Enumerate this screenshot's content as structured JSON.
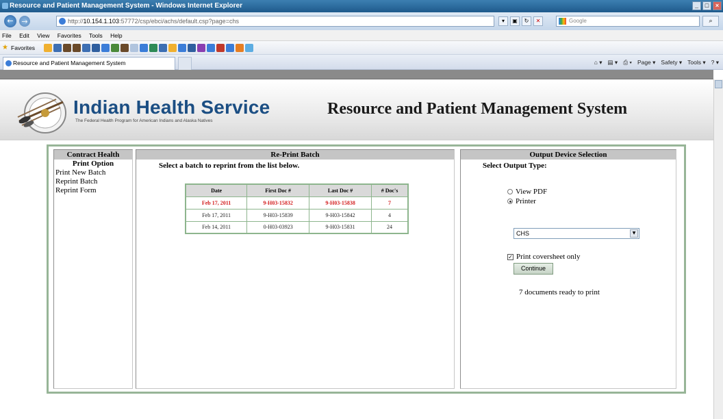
{
  "browser": {
    "window_title": "Resource and Patient Management System - Windows Internet Explorer",
    "url_prefix": "http://",
    "url_host": "10.154.1.103",
    "url_rest": ":57772/csp/ebci/achs/default.csp?page=chs",
    "search_placeholder": "Google",
    "menu": [
      "File",
      "Edit",
      "View",
      "Favorites",
      "Tools",
      "Help"
    ],
    "favorites_label": "Favorites",
    "tab_title": "Resource and Patient Management System",
    "commands": [
      "Page ▾",
      "Safety ▾",
      "Tools ▾"
    ]
  },
  "header": {
    "org_title": "Indian Health Service",
    "org_subtitle": "The Federal Health Program for American Indians and Alaska Natives",
    "system_title": "Resource and Patient Management System"
  },
  "left_panel": {
    "heading_line1": "Contract Health",
    "heading_line2": "Print Option",
    "items": [
      "Print New Batch",
      "Reprint Batch",
      "Reprint Form"
    ]
  },
  "mid_panel": {
    "heading": "Re-Print Batch",
    "instruction": "Select a batch to reprint from the list below.",
    "columns": [
      "Date",
      "First Doc #",
      "Last Doc #",
      "# Doc's"
    ],
    "rows": [
      {
        "date": "Feb 17, 2011",
        "first": "9-H03-15832",
        "last": "9-H03-15838",
        "count": "7"
      },
      {
        "date": "Feb 17, 2011",
        "first": "9-H03-15839",
        "last": "9-H03-15842",
        "count": "4"
      },
      {
        "date": "Feb 14, 2011",
        "first": "0-H03-03923",
        "last": "9-H03-15831",
        "count": "24"
      }
    ],
    "selected_row_color": "#d32020"
  },
  "right_panel": {
    "heading": "Output Device Selection",
    "output_type_label": "Select Output Type:",
    "option_pdf": "View PDF",
    "option_printer": "Printer",
    "selected_option": "Printer",
    "device_value": "CHS",
    "coversheet_label": "Print coversheet only",
    "coversheet_checked": true,
    "continue_label": "Continue",
    "status_text": "7 documents ready to print"
  }
}
